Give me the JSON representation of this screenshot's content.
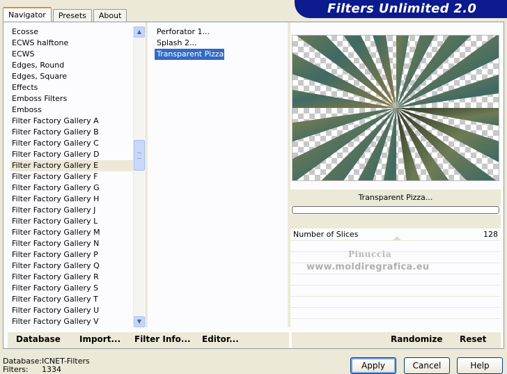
{
  "tabs": [
    "Navigator",
    "Presets",
    "About"
  ],
  "brand": {
    "title": "Filters Unlimited 2.0"
  },
  "categories": [
    "Ecosse",
    "ECWS halftone",
    "ECWS",
    "Edges, Round",
    "Edges, Square",
    "Effects",
    "Emboss Filters",
    "Emboss",
    "Filter Factory Gallery A",
    "Filter Factory Gallery B",
    "Filter Factory Gallery C",
    "Filter Factory Gallery D",
    "Filter Factory Gallery E",
    "Filter Factory Gallery F",
    "Filter Factory Gallery G",
    "Filter Factory Gallery H",
    "Filter Factory Gallery J",
    "Filter Factory Gallery L",
    "Filter Factory Gallery M",
    "Filter Factory Gallery N",
    "Filter Factory Gallery P",
    "Filter Factory Gallery Q",
    "Filter Factory Gallery R",
    "Filter Factory Gallery S",
    "Filter Factory Gallery T",
    "Filter Factory Gallery U",
    "Filter Factory Gallery V"
  ],
  "selected_category": "Filter Factory Gallery E",
  "filters": [
    "Perforator 1...",
    "Splash 2...",
    "Transparent Pizza..."
  ],
  "selected_filter": "Transparent Pizza...",
  "preview_filter_name": "Transparent Pizza...",
  "progress_fraction": 0,
  "params": [
    {
      "label": "Number of Slices",
      "value": "128"
    }
  ],
  "watermark": {
    "line1": "Pinuccia",
    "line2": "www.moldiregrafica.eu"
  },
  "actions_left": [
    "Database",
    "Import...",
    "Filter Info...",
    "Editor..."
  ],
  "actions_right": [
    "Randomize",
    "Reset"
  ],
  "status": {
    "database_label": "Database:",
    "database_value": "ICNET-Filters",
    "filters_label": "Filters:",
    "filters_value": "1334"
  },
  "dialog_buttons": [
    "Apply",
    "Cancel",
    "Help"
  ],
  "colors": {
    "header_bg": "#0b1a8c",
    "selection": "#316ac5",
    "tab_accent": "#e68b2c"
  }
}
